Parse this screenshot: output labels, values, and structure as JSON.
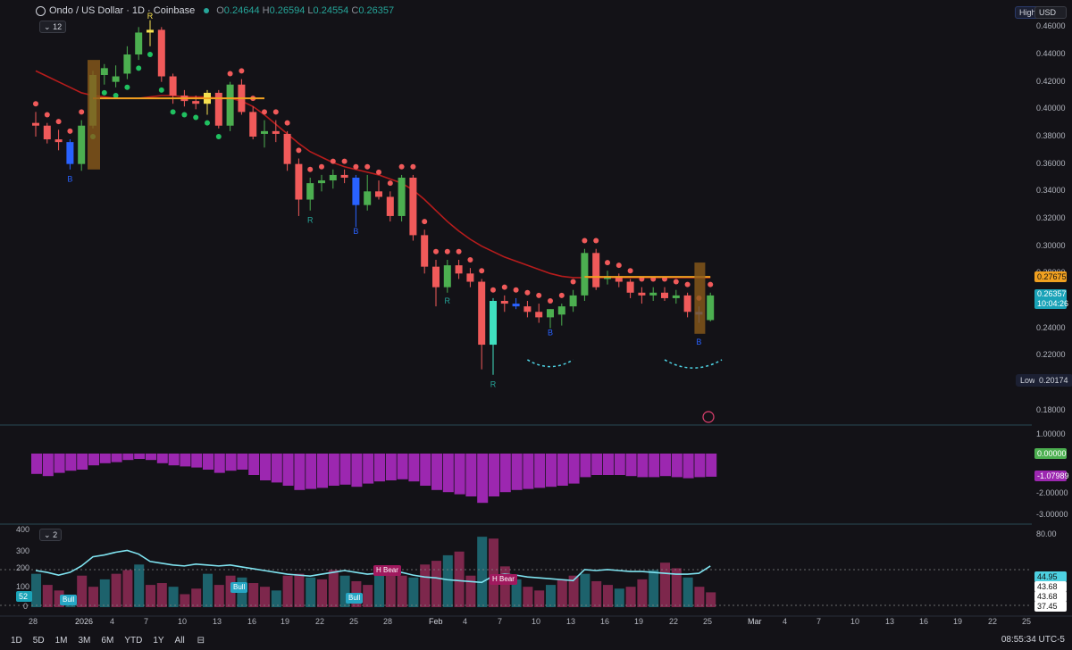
{
  "header": {
    "symbol": "Ondo / US Dollar · 1D · Coinbase",
    "open_label": "O",
    "open": "0.24644",
    "high_label": "H",
    "high": "0.26594",
    "low_label": "L",
    "low": "0.24554",
    "close_label": "C",
    "close": "0.26357",
    "indicator_count": "12"
  },
  "top_right": {
    "high_button": "High",
    "currency": "USD"
  },
  "price_axis": {
    "ticks": [
      "0.46000",
      "0.44000",
      "0.42000",
      "0.40000",
      "0.38000",
      "0.36000",
      "0.34000",
      "0.32000",
      "0.30000",
      "0.28000",
      "0.26000",
      "0.24000",
      "0.22000",
      "0.20000",
      "0.18000"
    ],
    "tag_a": "0.27675",
    "current_price": "0.26357",
    "countdown": "10:04:26",
    "low_label": "Low",
    "low_value": "0.20174"
  },
  "oscillator_axis": {
    "ticks": [
      "1.00000",
      "-2.00000",
      "-3.00000"
    ],
    "zero_tag": "0.00000",
    "value_tag": "-1.07989"
  },
  "rsi_panel": {
    "indicator_count": "2",
    "left_ticks": [
      "400",
      "300",
      "200",
      "100",
      "52",
      "0"
    ],
    "right_ticks": [
      "80.00",
      "44.95",
      "43.68",
      "43.68",
      "37.45"
    ],
    "labels": [
      "Bull",
      "Bull",
      "Bull",
      "H Bear",
      "H Bear"
    ]
  },
  "chart_labels": {
    "B": "B",
    "R": "R"
  },
  "time_axis": [
    "28",
    "2026",
    "4",
    "7",
    "10",
    "13",
    "16",
    "19",
    "22",
    "25",
    "28",
    "Feb",
    "4",
    "7",
    "10",
    "13",
    "16",
    "19",
    "22",
    "25",
    "Mar",
    "4",
    "7",
    "10",
    "13",
    "16",
    "19",
    "22",
    "25"
  ],
  "bottom_bar": {
    "timeframes": [
      "1D",
      "5D",
      "1M",
      "3M",
      "6M",
      "YTD",
      "1Y",
      "All"
    ],
    "clock": "08:55:34 UTC-5"
  },
  "chart_data": {
    "type": "candlestick",
    "title": "Ondo / US Dollar · 1D · Coinbase",
    "ylim": [
      0.17,
      0.47
    ],
    "x": [
      "Dec 28",
      "Dec 29",
      "Dec 30",
      "Dec 31",
      "Jan 1",
      "Jan 2",
      "Jan 3",
      "Jan 4",
      "Jan 5",
      "Jan 6",
      "Jan 7",
      "Jan 8",
      "Jan 9",
      "Jan 10",
      "Jan 11",
      "Jan 12",
      "Jan 13",
      "Jan 14",
      "Jan 15",
      "Jan 16",
      "Jan 17",
      "Jan 18",
      "Jan 19",
      "Jan 20",
      "Jan 21",
      "Jan 22",
      "Jan 23",
      "Jan 24",
      "Jan 25",
      "Jan 26",
      "Jan 27",
      "Jan 28",
      "Jan 29",
      "Jan 30",
      "Jan 31",
      "Feb 1",
      "Feb 2",
      "Feb 3",
      "Feb 4",
      "Feb 5",
      "Feb 6",
      "Feb 7",
      "Feb 8",
      "Feb 9",
      "Feb 10",
      "Feb 11",
      "Feb 12",
      "Feb 13",
      "Feb 14",
      "Feb 15",
      "Feb 16",
      "Feb 17",
      "Feb 18",
      "Feb 19",
      "Feb 20",
      "Feb 21",
      "Feb 22",
      "Feb 23",
      "Feb 24",
      "Feb 25"
    ],
    "ohlc": [
      [
        0.39,
        0.398,
        0.38,
        0.388
      ],
      [
        0.388,
        0.39,
        0.375,
        0.378
      ],
      [
        0.378,
        0.385,
        0.37,
        0.376
      ],
      [
        0.376,
        0.378,
        0.356,
        0.36
      ],
      [
        0.36,
        0.392,
        0.355,
        0.388
      ],
      [
        0.388,
        0.428,
        0.386,
        0.425
      ],
      [
        0.425,
        0.433,
        0.418,
        0.43
      ],
      [
        0.42,
        0.432,
        0.416,
        0.424
      ],
      [
        0.426,
        0.446,
        0.422,
        0.44
      ],
      [
        0.44,
        0.46,
        0.436,
        0.456
      ],
      [
        0.456,
        0.465,
        0.446,
        0.458
      ],
      [
        0.458,
        0.46,
        0.42,
        0.424
      ],
      [
        0.424,
        0.426,
        0.404,
        0.41
      ],
      [
        0.41,
        0.414,
        0.402,
        0.406
      ],
      [
        0.406,
        0.41,
        0.4,
        0.404
      ],
      [
        0.404,
        0.414,
        0.396,
        0.412
      ],
      [
        0.412,
        0.414,
        0.386,
        0.388
      ],
      [
        0.388,
        0.42,
        0.384,
        0.418
      ],
      [
        0.418,
        0.422,
        0.396,
        0.398
      ],
      [
        0.398,
        0.402,
        0.378,
        0.38
      ],
      [
        0.382,
        0.392,
        0.372,
        0.384
      ],
      [
        0.384,
        0.392,
        0.376,
        0.382
      ],
      [
        0.382,
        0.384,
        0.355,
        0.36
      ],
      [
        0.36,
        0.364,
        0.322,
        0.334
      ],
      [
        0.334,
        0.35,
        0.326,
        0.346
      ],
      [
        0.346,
        0.352,
        0.34,
        0.348
      ],
      [
        0.348,
        0.356,
        0.342,
        0.352
      ],
      [
        0.352,
        0.356,
        0.346,
        0.35
      ],
      [
        0.35,
        0.352,
        0.314,
        0.33
      ],
      [
        0.33,
        0.352,
        0.326,
        0.34
      ],
      [
        0.34,
        0.348,
        0.334,
        0.336
      ],
      [
        0.336,
        0.34,
        0.318,
        0.322
      ],
      [
        0.322,
        0.352,
        0.318,
        0.35
      ],
      [
        0.35,
        0.352,
        0.304,
        0.308
      ],
      [
        0.308,
        0.312,
        0.28,
        0.285
      ],
      [
        0.285,
        0.29,
        0.256,
        0.27
      ],
      [
        0.27,
        0.29,
        0.266,
        0.286
      ],
      [
        0.286,
        0.29,
        0.276,
        0.28
      ],
      [
        0.28,
        0.284,
        0.27,
        0.274
      ],
      [
        0.274,
        0.276,
        0.21,
        0.228
      ],
      [
        0.228,
        0.262,
        0.206,
        0.26
      ],
      [
        0.26,
        0.264,
        0.252,
        0.258
      ],
      [
        0.258,
        0.262,
        0.254,
        0.256
      ],
      [
        0.256,
        0.26,
        0.248,
        0.252
      ],
      [
        0.252,
        0.258,
        0.244,
        0.248
      ],
      [
        0.248,
        0.254,
        0.24,
        0.254
      ],
      [
        0.25,
        0.258,
        0.242,
        0.256
      ],
      [
        0.256,
        0.268,
        0.252,
        0.264
      ],
      [
        0.264,
        0.298,
        0.26,
        0.295
      ],
      [
        0.295,
        0.298,
        0.268,
        0.27
      ],
      [
        0.276,
        0.282,
        0.272,
        0.278
      ],
      [
        0.278,
        0.28,
        0.27,
        0.274
      ],
      [
        0.274,
        0.276,
        0.262,
        0.266
      ],
      [
        0.266,
        0.27,
        0.258,
        0.264
      ],
      [
        0.264,
        0.27,
        0.26,
        0.266
      ],
      [
        0.266,
        0.27,
        0.26,
        0.262
      ],
      [
        0.262,
        0.268,
        0.258,
        0.264
      ],
      [
        0.264,
        0.266,
        0.248,
        0.252
      ],
      [
        0.252,
        0.256,
        0.244,
        0.25
      ],
      [
        0.246,
        0.266,
        0.245,
        0.264
      ]
    ],
    "blue_candles": [
      3,
      28,
      42,
      58
    ],
    "cyan_candles": [
      40
    ],
    "highlight_candles": [
      10,
      15
    ],
    "ma_line": [
      0.428,
      0.424,
      0.42,
      0.416,
      0.412,
      0.41,
      0.409,
      0.408,
      0.408,
      0.408,
      0.409,
      0.41,
      0.41,
      0.409,
      0.409,
      0.409,
      0.408,
      0.408,
      0.406,
      0.402,
      0.396,
      0.389,
      0.382,
      0.375,
      0.369,
      0.365,
      0.361,
      0.358,
      0.356,
      0.354,
      0.352,
      0.349,
      0.346,
      0.341,
      0.334,
      0.326,
      0.318,
      0.311,
      0.305,
      0.3,
      0.296,
      0.292,
      0.289,
      0.286,
      0.283,
      0.28,
      0.278,
      0.277,
      0.277,
      0.277,
      0.277,
      0.277,
      0.277,
      0.277,
      0.277,
      0.277,
      0.277,
      0.277,
      0.277,
      0.277
    ],
    "oscillator": [
      -0.95,
      -1.05,
      -0.9,
      -0.8,
      -0.75,
      -0.55,
      -0.45,
      -0.4,
      -0.3,
      -0.25,
      -0.3,
      -0.45,
      -0.55,
      -0.6,
      -0.65,
      -0.75,
      -0.9,
      -0.8,
      -0.75,
      -1.0,
      -1.25,
      -1.35,
      -1.5,
      -1.7,
      -1.65,
      -1.6,
      -1.5,
      -1.45,
      -1.55,
      -1.4,
      -1.3,
      -1.25,
      -1.2,
      -1.3,
      -1.5,
      -1.7,
      -1.8,
      -1.9,
      -2.0,
      -2.3,
      -2.0,
      -1.8,
      -1.7,
      -1.65,
      -1.6,
      -1.55,
      -1.5,
      -1.4,
      -1.1,
      -1.0,
      -1.0,
      -1.0,
      -1.05,
      -1.1,
      -1.1,
      -1.05,
      -1.1,
      -1.15,
      -1.1,
      -1.08
    ],
    "volume": [
      180,
      120,
      90,
      60,
      170,
      110,
      150,
      180,
      200,
      230,
      120,
      130,
      110,
      70,
      100,
      180,
      120,
      170,
      160,
      130,
      110,
      90,
      170,
      180,
      160,
      150,
      200,
      170,
      140,
      120,
      180,
      200,
      170,
      160,
      230,
      250,
      280,
      300,
      170,
      380,
      370,
      220,
      150,
      110,
      90,
      120,
      150,
      170,
      180,
      140,
      120,
      100,
      110,
      150,
      200,
      240,
      210,
      160,
      110,
      80
    ],
    "rsi_line": [
      40,
      38,
      35,
      38,
      45,
      55,
      57,
      60,
      62,
      58,
      50,
      48,
      46,
      45,
      47,
      46,
      45,
      46,
      44,
      42,
      40,
      38,
      36,
      35,
      34,
      36,
      38,
      40,
      38,
      36,
      37,
      36,
      38,
      35,
      33,
      32,
      30,
      29,
      28,
      27,
      34,
      36,
      35,
      33,
      32,
      31,
      30,
      29,
      41,
      40,
      41,
      40,
      39,
      39,
      38,
      37,
      36,
      36,
      37,
      44.95
    ]
  }
}
